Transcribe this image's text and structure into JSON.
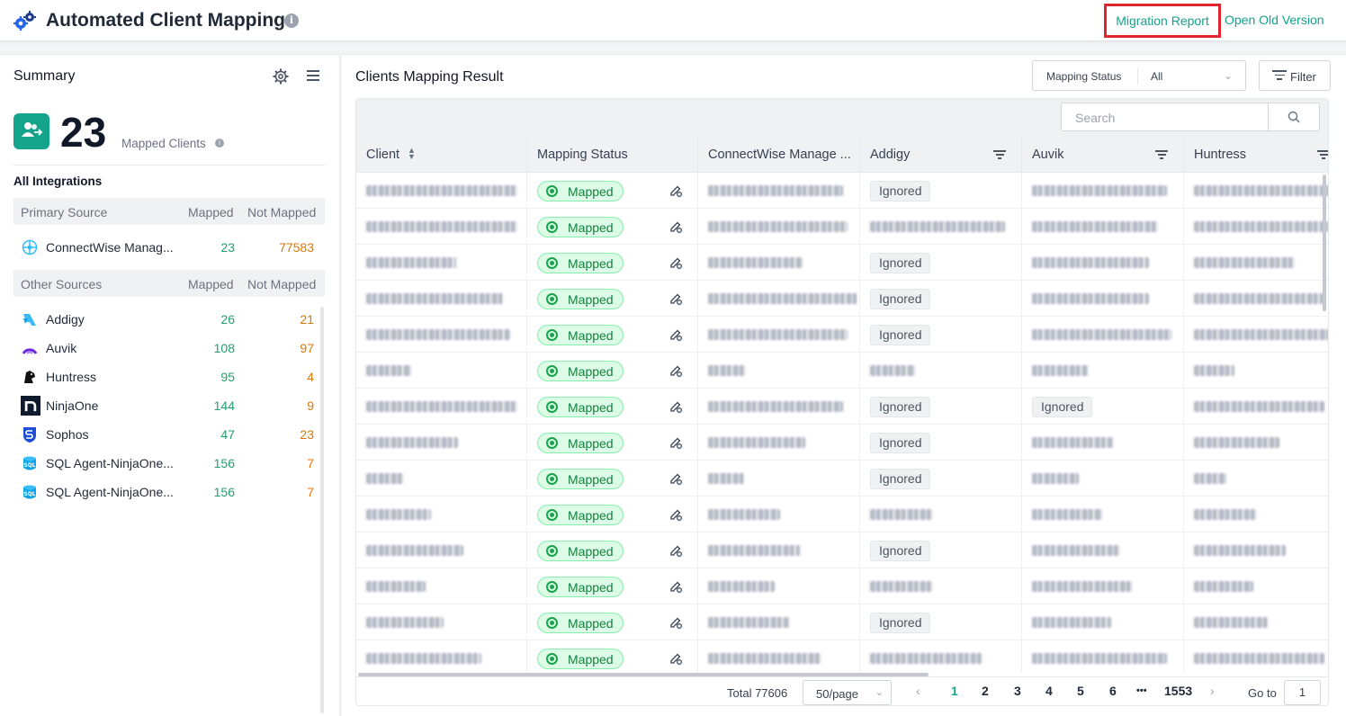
{
  "header": {
    "title": "Automated Client Mapping",
    "migration_report": "Migration Report",
    "open_old_version": "Open Old Version"
  },
  "summary": {
    "title": "Summary",
    "mapped_count": "23",
    "mapped_label": "Mapped Clients",
    "all_integrations": "All Integrations",
    "primary_head": {
      "source": "Primary Source",
      "mapped": "Mapped",
      "not_mapped": "Not Mapped"
    },
    "primary": [
      {
        "name": "ConnectWise Manag...",
        "mapped": "23",
        "not_mapped": "77583",
        "icon": "connectwise-icon"
      }
    ],
    "other_head": {
      "source": "Other Sources",
      "mapped": "Mapped",
      "not_mapped": "Not Mapped"
    },
    "others": [
      {
        "name": "Addigy",
        "mapped": "26",
        "not_mapped": "21",
        "icon": "addigy-icon"
      },
      {
        "name": "Auvik",
        "mapped": "108",
        "not_mapped": "97",
        "icon": "auvik-icon"
      },
      {
        "name": "Huntress",
        "mapped": "95",
        "not_mapped": "4",
        "icon": "huntress-icon"
      },
      {
        "name": "NinjaOne",
        "mapped": "144",
        "not_mapped": "9",
        "icon": "ninjaone-icon"
      },
      {
        "name": "Sophos",
        "mapped": "47",
        "not_mapped": "23",
        "icon": "sophos-icon"
      },
      {
        "name": "SQL Agent-NinjaOne...",
        "mapped": "156",
        "not_mapped": "7",
        "icon": "sql-agent-icon"
      },
      {
        "name": "SQL Agent-NinjaOne...",
        "mapped": "156",
        "not_mapped": "7",
        "icon": "sql-agent-icon"
      }
    ]
  },
  "main": {
    "title": "Clients Mapping Result",
    "mapping_status_label": "Mapping Status",
    "mapping_status_value": "All",
    "filter_label": "Filter",
    "search_placeholder": "Search",
    "columns": [
      "Client",
      "Mapping Status",
      "ConnectWise Manage ...",
      "Addigy",
      "Auvik",
      "Huntress"
    ],
    "mapped_badge": "Mapped",
    "ignored_label": "Ignored",
    "rows": [
      {
        "status": "Mapped",
        "addigy": "Ignored",
        "auvik": ""
      },
      {
        "status": "Mapped",
        "addigy": "",
        "auvik": ""
      },
      {
        "status": "Mapped",
        "addigy": "Ignored",
        "auvik": ""
      },
      {
        "status": "Mapped",
        "addigy": "Ignored",
        "auvik": ""
      },
      {
        "status": "Mapped",
        "addigy": "Ignored",
        "auvik": ""
      },
      {
        "status": "Mapped",
        "addigy": "",
        "auvik": ""
      },
      {
        "status": "Mapped",
        "addigy": "Ignored",
        "auvik": "Ignored"
      },
      {
        "status": "Mapped",
        "addigy": "Ignored",
        "auvik": ""
      },
      {
        "status": "Mapped",
        "addigy": "Ignored",
        "auvik": ""
      },
      {
        "status": "Mapped",
        "addigy": "",
        "auvik": ""
      },
      {
        "status": "Mapped",
        "addigy": "Ignored",
        "auvik": ""
      },
      {
        "status": "Mapped",
        "addigy": "",
        "auvik": ""
      },
      {
        "status": "Mapped",
        "addigy": "Ignored",
        "auvik": ""
      },
      {
        "status": "Mapped",
        "addigy": "",
        "auvik": ""
      }
    ],
    "pagination": {
      "total": "Total 77606",
      "page_size": "50/page",
      "pages": [
        "1",
        "2",
        "3",
        "4",
        "5",
        "6",
        "•••",
        "1553"
      ],
      "active": "1",
      "goto_label": "Go to",
      "goto_value": "1"
    }
  },
  "colors": {
    "accent": "#14a38b",
    "mapped_green": "#22a06b",
    "not_mapped_orange": "#d97706",
    "highlight_red": "#e0242b"
  }
}
